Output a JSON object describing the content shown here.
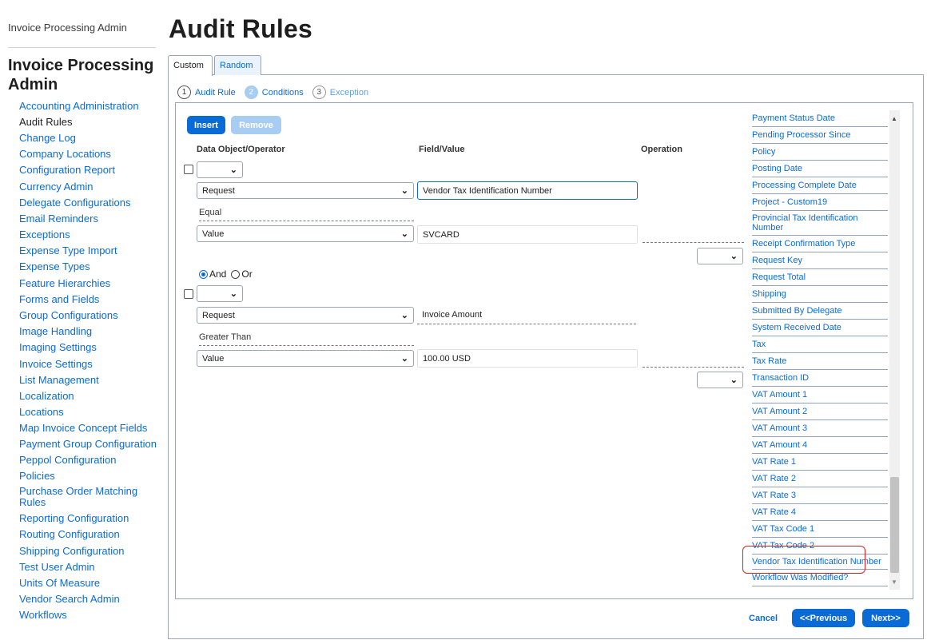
{
  "sidebar": {
    "top_link": "Invoice Processing Admin",
    "heading": "Invoice Processing Admin",
    "items": [
      {
        "label": "Accounting Administration"
      },
      {
        "label": "Audit Rules"
      },
      {
        "label": "Change Log"
      },
      {
        "label": "Company Locations"
      },
      {
        "label": "Configuration Report"
      },
      {
        "label": "Currency Admin"
      },
      {
        "label": "Delegate Configurations"
      },
      {
        "label": "Email Reminders"
      },
      {
        "label": "Exceptions"
      },
      {
        "label": "Expense Type Import"
      },
      {
        "label": "Expense Types"
      },
      {
        "label": "Feature Hierarchies"
      },
      {
        "label": "Forms and Fields"
      },
      {
        "label": "Group Configurations"
      },
      {
        "label": "Image Handling"
      },
      {
        "label": "Imaging Settings"
      },
      {
        "label": "Invoice Settings"
      },
      {
        "label": "List Management"
      },
      {
        "label": "Localization"
      },
      {
        "label": "Locations"
      },
      {
        "label": "Map Invoice Concept Fields"
      },
      {
        "label": "Payment Group Configuration"
      },
      {
        "label": "Peppol Configuration"
      },
      {
        "label": "Policies"
      },
      {
        "label": "Purchase Order Matching Rules"
      },
      {
        "label": "Reporting Configuration"
      },
      {
        "label": "Routing Configuration"
      },
      {
        "label": "Shipping Configuration"
      },
      {
        "label": "Test User Admin"
      },
      {
        "label": "Units Of Measure"
      },
      {
        "label": "Vendor Search Admin"
      },
      {
        "label": "Workflows"
      }
    ]
  },
  "page": {
    "title": "Audit Rules"
  },
  "tabs": [
    {
      "label": "Custom"
    },
    {
      "label": "Random"
    }
  ],
  "steps": [
    {
      "num": "1",
      "label": "Audit Rule"
    },
    {
      "num": "2",
      "label": "Conditions"
    },
    {
      "num": "3",
      "label": "Exception"
    }
  ],
  "toolbar": {
    "insert": "Insert",
    "remove": "Remove"
  },
  "columns": {
    "data_object": "Data Object/Operator",
    "field_value": "Field/Value",
    "operation": "Operation"
  },
  "conditions": [
    {
      "object_select": "Request",
      "field_value": "Vendor Tax Identification Number",
      "operator": "Equal",
      "value_select": "Value",
      "value": "SVCARD"
    },
    {
      "object_select": "Request",
      "field_value": "Invoice Amount",
      "operator": "Greater Than",
      "value_select": "Value",
      "value": "100.00 USD"
    }
  ],
  "connector": {
    "and": "And",
    "or": "Or",
    "selected": "And"
  },
  "field_list": [
    "Payment Status Date",
    "Pending Processor Since",
    "Policy",
    "Posting Date",
    "Processing Complete Date",
    "Project - Custom19",
    "Provincial Tax Identification Number",
    "Receipt Confirmation Type",
    "Request Key",
    "Request Total",
    "Shipping",
    "Submitted By Delegate",
    "System Received Date",
    "Tax",
    "Tax Rate",
    "Transaction ID",
    "VAT Amount 1",
    "VAT Amount 2",
    "VAT Amount 3",
    "VAT Amount 4",
    "VAT Rate 1",
    "VAT Rate 2",
    "VAT Rate 3",
    "VAT Rate 4",
    "VAT Tax Code 1",
    "VAT Tax Code 2",
    "Vendor Tax Identification Number",
    "Workflow Was Modified?"
  ],
  "footer": {
    "cancel": "Cancel",
    "previous": "<<Previous",
    "next": "Next>>"
  },
  "colors": {
    "accent": "#0a6bd6",
    "accent_light": "#a8cdf2",
    "highlight": "#e02020"
  }
}
